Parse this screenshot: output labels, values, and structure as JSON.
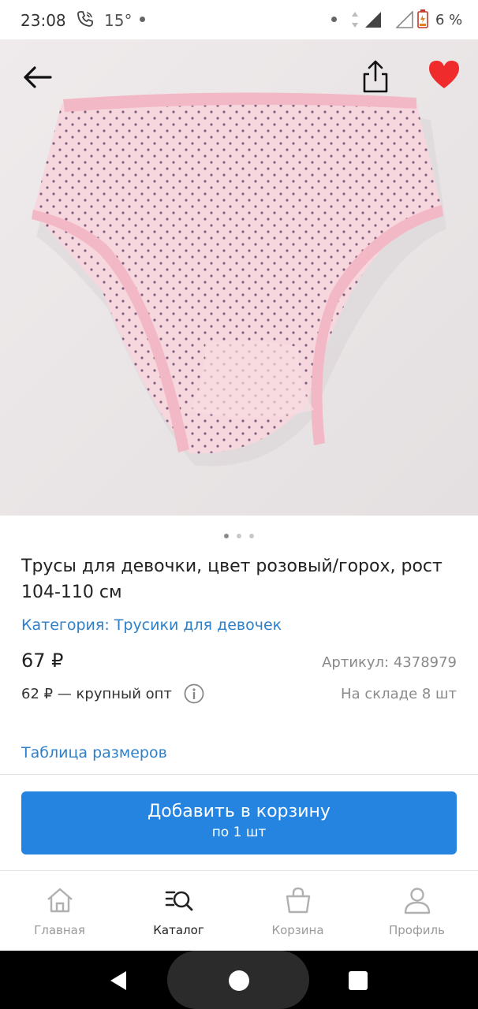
{
  "status_bar": {
    "time": "23:08",
    "temperature": "15°",
    "battery": "6 %",
    "phone_icon": "phone-wifi-icon",
    "signal_icon": "signal-icon"
  },
  "gallery": {
    "image_subject": "pink polka-dot girls' briefs",
    "back_icon": "arrow-left-icon",
    "share_icon": "share-icon",
    "favorite_icon": "heart-icon",
    "favorite_color": "#f02b2b",
    "page_count": 3,
    "current_page": 1
  },
  "product": {
    "title": "Трусы для девочки, цвет розовый/горох, рост 104-110 см",
    "category": "Категория: Трусики для девочек",
    "price": "67 ₽",
    "sku": "Артикул: 4378979",
    "wholesale": "62 ₽ — крупный опт",
    "stock": "На складе 8 шт",
    "size_table": "Таблица размеров"
  },
  "cart_button": {
    "label": "Добавить в корзину",
    "sublabel": "по 1 шт",
    "color": "#2484e0"
  },
  "bottom_nav": {
    "items": [
      {
        "label": "Главная",
        "icon": "home-icon",
        "active": false
      },
      {
        "label": "Каталог",
        "icon": "catalog-search-icon",
        "active": true
      },
      {
        "label": "Корзина",
        "icon": "cart-bag-icon",
        "active": false
      },
      {
        "label": "Профиль",
        "icon": "profile-icon",
        "active": false
      }
    ]
  },
  "colors": {
    "link": "#2f80c8",
    "accent": "#2484e0"
  }
}
